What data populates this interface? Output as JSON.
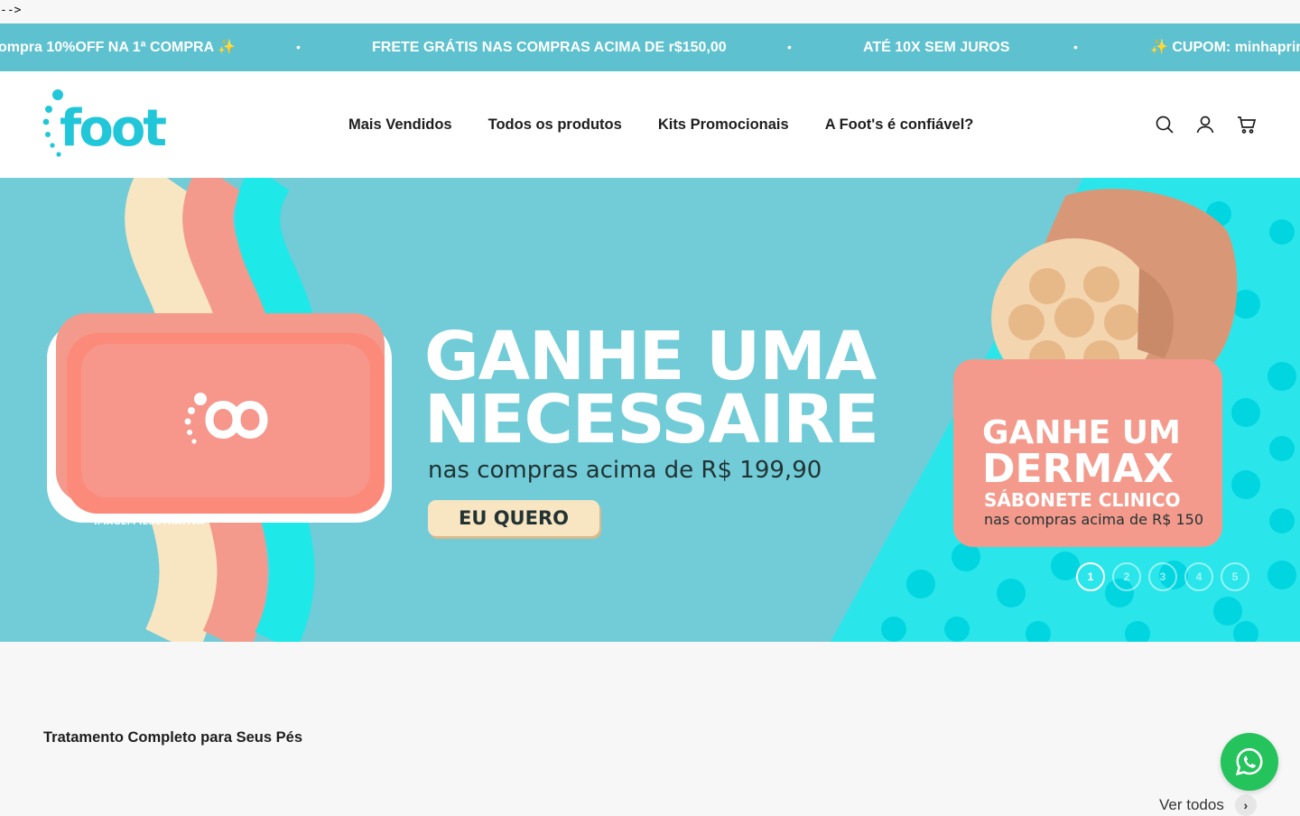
{
  "stray_text": "-->",
  "announcement": {
    "items": [
      "ompra 10%OFF NA 1ª COMPRA ✨",
      "FRETE GRÁTIS NAS COMPRAS ACIMA DE r$150,00",
      "ATÉ 10X SEM JUROS",
      "✨ CUPOM: minhaprim"
    ],
    "separator": "•"
  },
  "header": {
    "logo_alt": "Foot's",
    "nav": [
      "Mais Vendidos",
      "Todos os produtos",
      "Kits Promocionais",
      "A Foot's é confiável?"
    ],
    "icons": [
      "search-icon",
      "account-icon",
      "cart-icon"
    ]
  },
  "hero": {
    "headline_line1": "GANHE UMA",
    "headline_line2": "NECESSAIRE",
    "subline": "nas compras acima de R$ 199,90",
    "cta": "EU QUERO",
    "illustrative": "IMAGEM ILUSTRATIVA",
    "promo": {
      "line1": "GANHE UM",
      "line2": "DERMAX",
      "line3": "SÁBONETE CLINICO",
      "line4": "nas compras acima de R$ 150"
    },
    "slides": [
      "1",
      "2",
      "3",
      "4",
      "5"
    ],
    "active_slide": 1,
    "colors": {
      "teal": "#71ccd8",
      "coral": "#f49a8c",
      "cream": "#f8e5c2",
      "cyan": "#1ee8e8"
    }
  },
  "section": {
    "title": "Tratamento Completo para Seus Pés",
    "see_all": "Ver todos"
  },
  "whatsapp": {
    "icon": "whatsapp-icon",
    "color": "#25c35c"
  }
}
